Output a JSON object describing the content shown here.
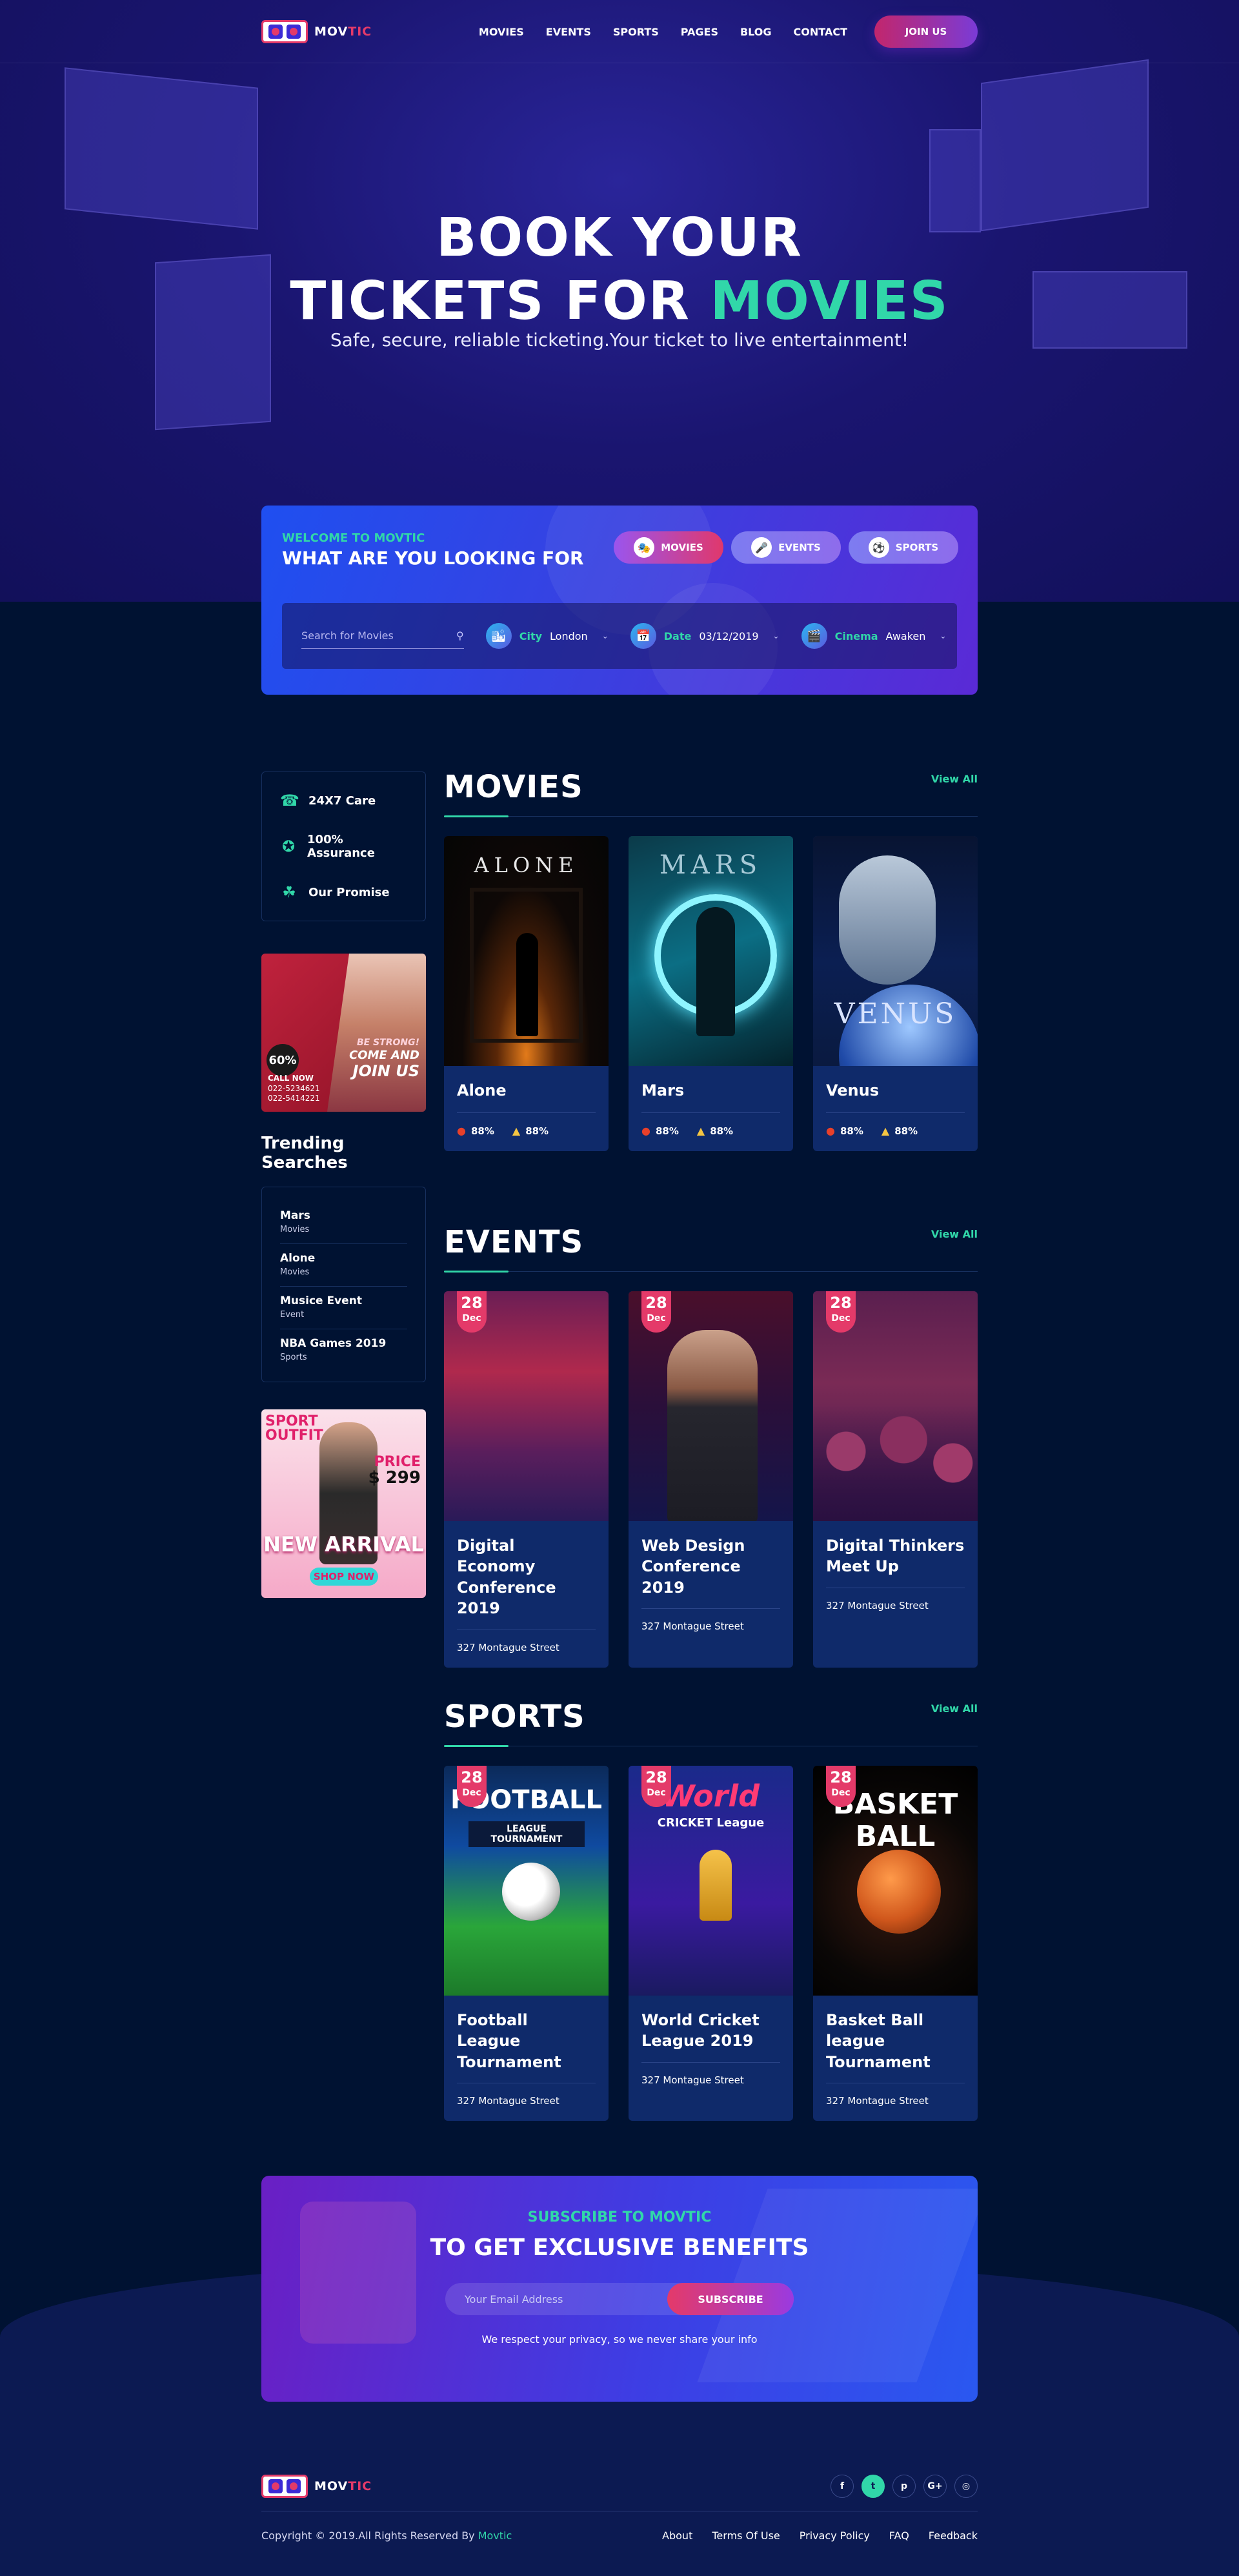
{
  "header": {
    "logo": {
      "text_main": "MOV",
      "text_accent": "TIC"
    },
    "nav": [
      "MOVIES",
      "EVENTS",
      "SPORTS",
      "PAGES",
      "BLOG",
      "CONTACT"
    ],
    "join_label": "JOIN US"
  },
  "hero": {
    "line1": "BOOK YOUR",
    "line2_plain": "TICKETS FOR",
    "line2_accent": "MOVIES",
    "subtitle": "Safe, secure, reliable ticketing.Your ticket to live entertainment!"
  },
  "search": {
    "welcome": "WELCOME TO MOVTIC",
    "title": "WHAT ARE YOU LOOKING FOR",
    "tabs": [
      {
        "label": "MOVIES",
        "icon": "ticket-icon"
      },
      {
        "label": "EVENTS",
        "icon": "microphone-icon"
      },
      {
        "label": "SPORTS",
        "icon": "ball-icon"
      }
    ],
    "placeholder": "Search for Movies",
    "city": {
      "label": "City",
      "value": "London"
    },
    "date": {
      "label": "Date",
      "value": "03/12/2019"
    },
    "cinema": {
      "label": "Cinema",
      "value": "Awaken"
    }
  },
  "sidebar": {
    "features": [
      "24X7 Care",
      "100% Assurance",
      "Our Promise"
    ],
    "ad1": {
      "discount": "60%",
      "line1": "BE STRONG!",
      "line2": "COME AND",
      "line3": "JOIN US",
      "call_label": "CALL NOW",
      "phone1": "022-5234621",
      "phone2": "022-5414221"
    },
    "trending_title": "Trending Searches",
    "trending": [
      {
        "title": "Mars",
        "category": "Movies"
      },
      {
        "title": "Alone",
        "category": "Movies"
      },
      {
        "title": "Musice Event",
        "category": "Event"
      },
      {
        "title": "NBA Games 2019",
        "category": "Sports"
      }
    ],
    "ad2": {
      "line1": "SPORT",
      "line2": "OUTFIT",
      "price_label": "PRICE",
      "price": "$ 299",
      "headline": "NEW ARRIVAL",
      "cta": "SHOP NOW"
    }
  },
  "movies": {
    "heading": "MOVIES",
    "view_all": "View All",
    "items": [
      {
        "title": "Alone",
        "poster_text": "ALONE",
        "rating_tomato": "88%",
        "rating_audience": "88%"
      },
      {
        "title": "Mars",
        "poster_text": "MARS",
        "rating_tomato": "88%",
        "rating_audience": "88%"
      },
      {
        "title": "Venus",
        "poster_text": "VENUS",
        "rating_tomato": "88%",
        "rating_audience": "88%"
      }
    ]
  },
  "events": {
    "heading": "EVENTS",
    "view_all": "View All",
    "items": [
      {
        "title": "Digital Economy Conference 2019",
        "day": "28",
        "month": "Dec",
        "address": "327 Montague Street"
      },
      {
        "title": "Web Design Conference 2019",
        "day": "28",
        "month": "Dec",
        "address": "327 Montague Street"
      },
      {
        "title": "Digital Thinkers Meet Up",
        "day": "28",
        "month": "Dec",
        "address": "327 Montague Street"
      }
    ]
  },
  "sports": {
    "heading": "SPORTS",
    "view_all": "View All",
    "items": [
      {
        "title": "Football League Tournament",
        "day": "28",
        "month": "Dec",
        "address": "327 Montague Street",
        "poster_text": "FOOTBALL",
        "poster_sub": "LEAGUE TOURNAMENT"
      },
      {
        "title": "World Cricket League 2019",
        "day": "28",
        "month": "Dec",
        "address": "327 Montague Street",
        "poster_text": "World",
        "poster_sub": "CRICKET League"
      },
      {
        "title": "Basket Ball league Tournament",
        "day": "28",
        "month": "Dec",
        "address": "327 Montague Street",
        "poster_text": "BASKET",
        "poster_sub": "BALL"
      }
    ]
  },
  "subscribe": {
    "pre": "SUBSCRIBE TO MOVTIC",
    "title": "TO GET EXCLUSIVE BENEFITS",
    "placeholder": "Your Email Address",
    "button": "SUBSCRIBE",
    "note": "We respect your privacy, so we never share your info"
  },
  "footer": {
    "copyright": "Copyright © 2019.All Rights Reserved By",
    "brand": "Movtic",
    "links": [
      "About",
      "Terms Of Use",
      "Privacy Policy",
      "FAQ",
      "Feedback"
    ],
    "social": [
      "f",
      "t",
      "p",
      "G+",
      "◎"
    ]
  },
  "colors": {
    "accent": "#31d7a9",
    "brand_pink": "#e43a69",
    "background": "#001232",
    "card": "#0f2a6a"
  }
}
